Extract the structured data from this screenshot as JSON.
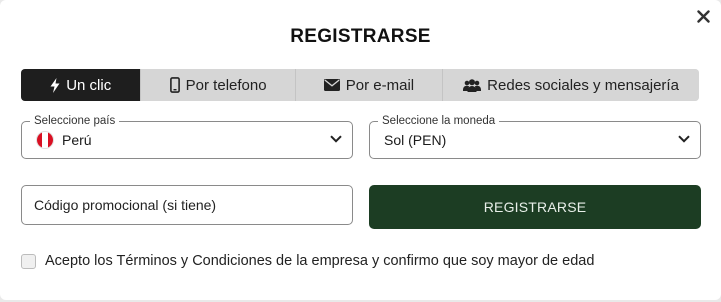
{
  "dialog": {
    "title": "REGISTRARSE"
  },
  "tabs": [
    {
      "label": "Un clic",
      "icon": "lightning-icon",
      "active": true
    },
    {
      "label": "Por telefono",
      "icon": "phone-icon",
      "active": false
    },
    {
      "label": "Por e-mail",
      "icon": "envelope-icon",
      "active": false
    },
    {
      "label": "Redes sociales y mensajería",
      "icon": "users-icon",
      "active": false
    }
  ],
  "country": {
    "legend": "Seleccione país",
    "value": "Perú",
    "flag_colors": [
      "#d91023",
      "#ffffff",
      "#d91023"
    ]
  },
  "currency": {
    "legend": "Seleccione la moneda",
    "value": "Sol (PEN)"
  },
  "promo": {
    "placeholder": "Código promocional (si tiene)"
  },
  "submit": {
    "label": "REGISTRARSE"
  },
  "terms": {
    "label": "Acepto los Términos y Condiciones de la empresa y confirmo que soy mayor de edad",
    "checked": false
  },
  "colors": {
    "accent_dark": "#1c3d23",
    "tab_active": "#1e1e1e",
    "tab_inactive": "#d6d6d6"
  }
}
